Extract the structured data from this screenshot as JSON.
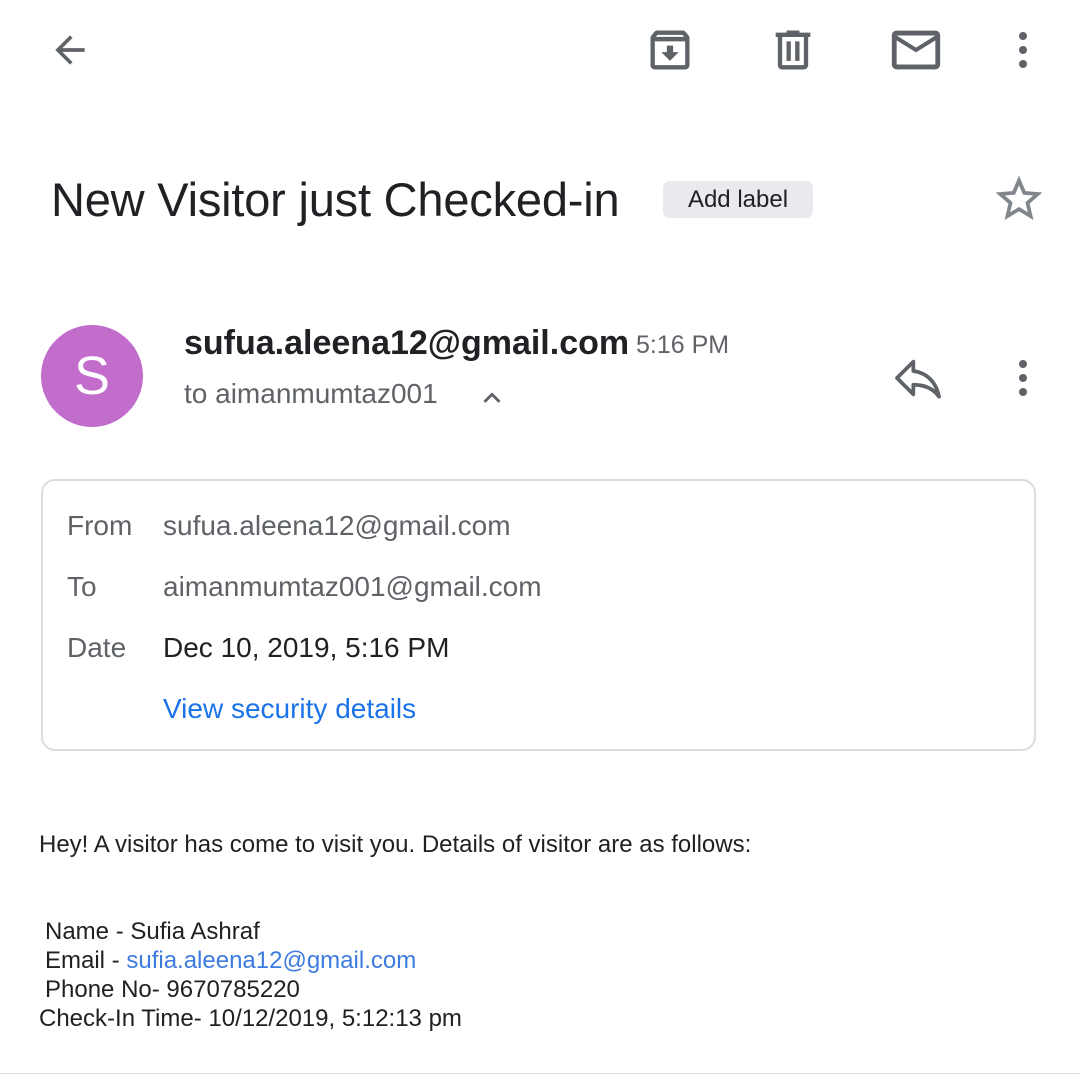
{
  "toolbar": {
    "back_icon": "arrow-left-icon",
    "archive_icon": "archive-icon",
    "delete_icon": "trash-icon",
    "mark_unread_icon": "mail-icon",
    "more_icon": "more-vertical-icon"
  },
  "subject": {
    "title": "New Visitor just Checked-in",
    "add_label": "Add label",
    "star_icon": "star-outline-icon"
  },
  "message_header": {
    "avatar_letter": "S",
    "avatar_color": "#c26ccb",
    "sender": "sufua.aleena12@gmail.com",
    "time": "5:16 PM",
    "to_line": "to aimanmumtaz001",
    "collapse_icon": "chevron-up-icon",
    "reply_icon": "reply-icon",
    "more_icon": "more-vertical-icon"
  },
  "details": {
    "from_label": "From",
    "from_value": "sufua.aleena12@gmail.com",
    "to_label": "To",
    "to_value": "aimanmumtaz001@gmail.com",
    "date_label": "Date",
    "date_value": "Dec 10, 2019, 5:16 PM",
    "security_link": "View security details"
  },
  "body": {
    "intro": "Hey! A visitor has come to visit you. Details of visitor are as follows:",
    "name_line": "Name - Sufia Ashraf",
    "email_prefix": "Email - ",
    "email_link": "sufia.aleena12@gmail.com",
    "phone_line": "Phone No- 9670785220",
    "checkin_line": "Check-In Time- 10/12/2019, 5:12:13 pm"
  },
  "colors": {
    "link_blue": "#1a73e8",
    "icon_gray": "#5f6368",
    "text_dark": "#202124"
  }
}
